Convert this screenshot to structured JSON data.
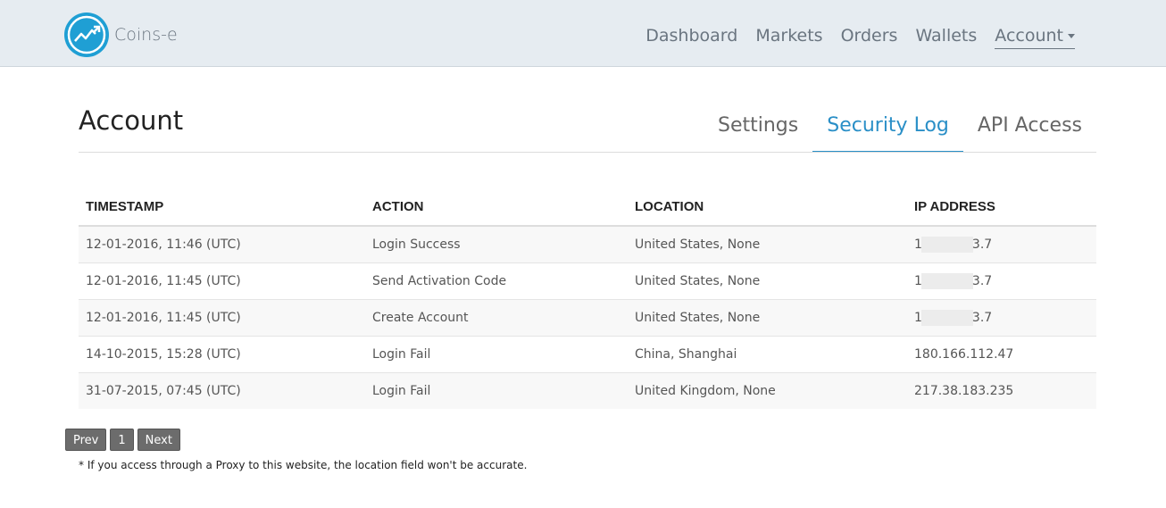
{
  "brand": {
    "name": "Coins-e",
    "logo_icon": "trend-arrow-icon",
    "logo_color": "#1f9fd4"
  },
  "nav": {
    "dashboard": "Dashboard",
    "markets": "Markets",
    "orders": "Orders",
    "wallets": "Wallets",
    "account": "Account"
  },
  "page": {
    "title": "Account",
    "tabs": [
      "Settings",
      "Security Log",
      "API Access"
    ],
    "active_tab": "Security Log",
    "accent_color": "#2a8fc7"
  },
  "table": {
    "headers": [
      "TIMESTAMP",
      "ACTION",
      "LOCATION",
      "IP ADDRESS"
    ],
    "rows": [
      {
        "timestamp": "12-01-2016, 11:46 (UTC)",
        "action": "Login Success",
        "location": "United States, None",
        "ip_start": "1",
        "ip_end": "3.7",
        "redacted": true
      },
      {
        "timestamp": "12-01-2016, 11:45 (UTC)",
        "action": "Send Activation Code",
        "location": "United States, None",
        "ip_start": "1",
        "ip_end": "3.7",
        "redacted": true
      },
      {
        "timestamp": "12-01-2016, 11:45 (UTC)",
        "action": "Create Account",
        "location": "United States, None",
        "ip_start": "1",
        "ip_end": "3.7",
        "redacted": true
      },
      {
        "timestamp": "14-10-2015, 15:28 (UTC)",
        "action": "Login Fail",
        "location": "China, Shanghai",
        "ip": "180.166.112.47"
      },
      {
        "timestamp": "31-07-2015, 07:45 (UTC)",
        "action": "Login Fail",
        "location": "United Kingdom, None",
        "ip": "217.38.183.235"
      }
    ]
  },
  "pagination": {
    "prev": "Prev",
    "page": "1",
    "next": "Next"
  },
  "note": "* If you access through a Proxy to this website, the location field won't be accurate."
}
